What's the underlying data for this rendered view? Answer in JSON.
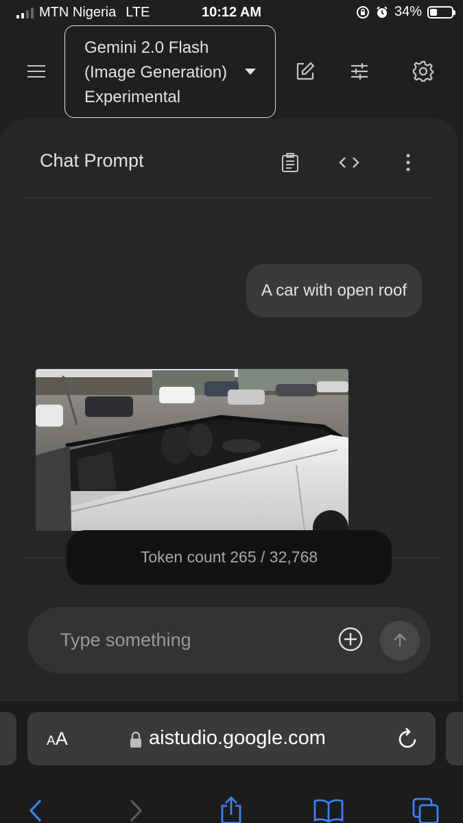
{
  "status_bar": {
    "carrier": "MTN Nigeria",
    "network": "LTE",
    "time": "10:12 AM",
    "battery_percent": "34%",
    "battery_level": 0.34
  },
  "header": {
    "model_name": "Gemini 2.0 Flash\n(Image Generation)\nExperimental",
    "icons": [
      "menu-icon",
      "edit-icon",
      "tune-icon",
      "settings-icon"
    ]
  },
  "chat": {
    "title": "Chat Prompt",
    "header_icons": [
      "clipboard-icon",
      "code-icon",
      "more-vert-icon"
    ],
    "user_message": "A car with open roof",
    "token_count": "Token count 265 / 32,768"
  },
  "composer": {
    "placeholder": "Type something"
  },
  "browser": {
    "text_size_label_small": "A",
    "text_size_label_large": "A",
    "url": "aistudio.google.com"
  },
  "colors": {
    "background": "#1f1f1f",
    "panel": "#262626",
    "bubble": "#3a3a3a",
    "safari_blue": "#3b82f6"
  }
}
